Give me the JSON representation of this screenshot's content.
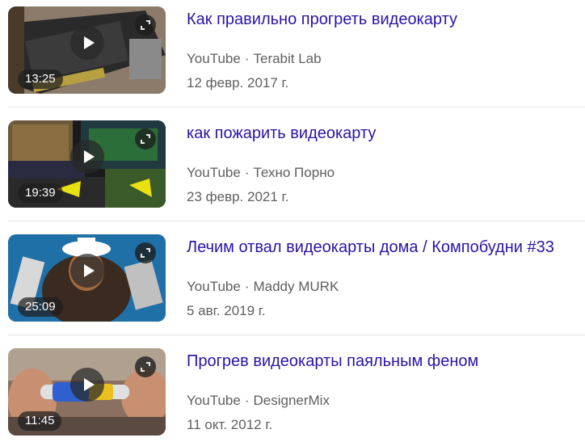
{
  "results": [
    {
      "title": "Как правильно прогреть видеокарту",
      "platform": "YouTube",
      "separator": "·",
      "channel": "Terabit Lab",
      "date": "12 февр. 2017 г.",
      "duration": "13:25"
    },
    {
      "title": "как пожарить видеокарту",
      "platform": "YouTube",
      "separator": "·",
      "channel": "Техно Порно",
      "date": "23 февр. 2021 г.",
      "duration": "19:39"
    },
    {
      "title": "Лечим отвал видеокарты дома / Компобудни #33",
      "platform": "YouTube",
      "separator": "·",
      "channel": "Maddy MURK",
      "date": "5 авг. 2019 г.",
      "duration": "25:09"
    },
    {
      "title": "Прогрев видеокарты паяльным феном",
      "platform": "YouTube",
      "separator": "·",
      "channel": "DesignerMix",
      "date": "11 окт. 2012 г.",
      "duration": "11:45"
    }
  ],
  "icons": {
    "play": "play-icon",
    "expand": "expand-icon"
  },
  "colors": {
    "title_link": "#2a14a8",
    "meta_text": "#5f5f5f",
    "divider": "#e8e8e8",
    "overlay": "#1e1e1e"
  }
}
